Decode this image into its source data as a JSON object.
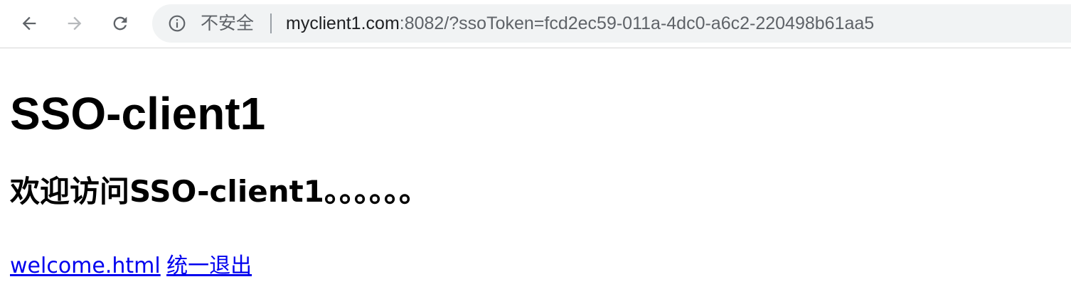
{
  "browser": {
    "security_label": "不安全",
    "url_host": "myclient1.com",
    "url_rest": ":8082/?ssoToken=fcd2ec59-011a-4dc0-a6c2-220498b61aa5",
    "icons": {
      "back": "arrow-left-icon",
      "forward": "arrow-right-icon",
      "reload": "reload-icon",
      "info": "info-icon"
    }
  },
  "page": {
    "heading": "SSO-client1",
    "welcome": "欢迎访问SSO-client1。。。。。。",
    "links": [
      {
        "label": "welcome.html"
      },
      {
        "label": "统一退出"
      }
    ],
    "link_color": "#0000ee"
  }
}
